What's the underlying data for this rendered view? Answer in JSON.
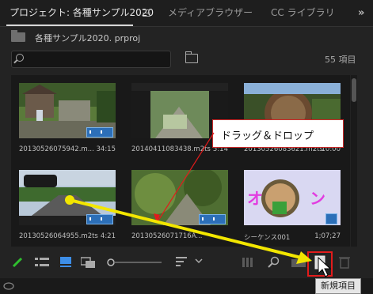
{
  "tabs": [
    {
      "label": "プロジェクト: 各種サンプル2020"
    },
    {
      "label": "メディアブラウザー"
    },
    {
      "label": "CC ライブラリ"
    }
  ],
  "tabs_overflow": "»",
  "project": {
    "name": "各種サンプル2020. prproj"
  },
  "search": {
    "placeholder": "",
    "value": ""
  },
  "items_count": "55 項目",
  "clips": [
    {
      "name": "20130526075942.m...",
      "duration": "34:15"
    },
    {
      "name": "20140411083438.m2ts",
      "duration": "5:14"
    },
    {
      "name": "20130526083621.m2ts",
      "duration": "10:00"
    },
    {
      "name": "20130526064955.m2ts",
      "duration": "4:21"
    },
    {
      "name": "20130526071716A...",
      "duration": ""
    },
    {
      "name": "シーケンス001",
      "duration": "1;07;27"
    }
  ],
  "sequence_title_text": "オ ング",
  "callout": {
    "text": "ドラッグ＆ドロップ"
  },
  "tooltip": {
    "text": "新規項目"
  },
  "colors": {
    "accent_arrow": "#f2e600",
    "highlight": "#e21b1b",
    "badge": "#2c6fb8",
    "pen": "#2fbf2f"
  },
  "icons": [
    "folder-icon",
    "search-icon",
    "new-bin-icon",
    "pen-icon",
    "list-view-icon",
    "icon-view-icon",
    "freeform-view-icon",
    "zoom-slider",
    "sort-icon",
    "automate-icon",
    "find-icon",
    "new-bin-icon",
    "new-item-icon",
    "trash-icon"
  ]
}
